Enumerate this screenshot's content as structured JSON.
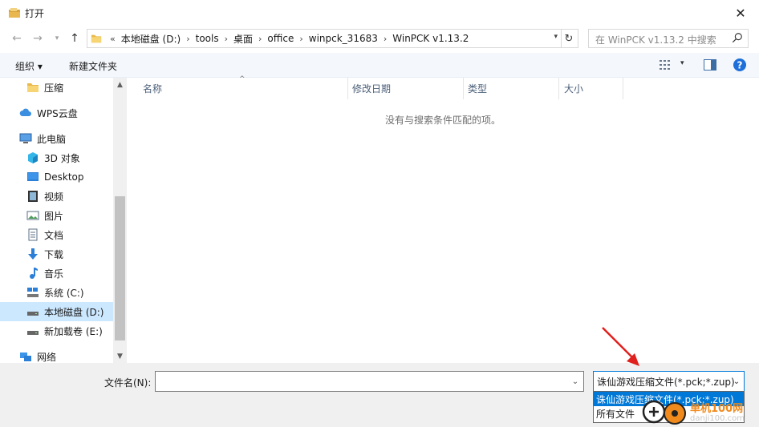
{
  "window": {
    "title": "打开",
    "close_glyph": "✕"
  },
  "address": {
    "overflow": "«",
    "crumbs": [
      "本地磁盘 (D:)",
      "tools",
      "桌面",
      "office",
      "winpck_31683",
      "WinPCK v1.13.2"
    ],
    "separator": "›"
  },
  "search": {
    "placeholder": "在 WinPCK v1.13.2 中搜索"
  },
  "toolbar": {
    "organize": "组织 ▾",
    "new_folder": "新建文件夹"
  },
  "sidebar": {
    "items": [
      {
        "label": "压缩",
        "icon": "folder-icon"
      },
      {
        "label": "WPS云盘",
        "icon": "cloud-icon"
      },
      {
        "label": "此电脑",
        "icon": "computer-icon"
      },
      {
        "label": "3D 对象",
        "icon": "3d-objects-icon"
      },
      {
        "label": "Desktop",
        "icon": "desktop-icon"
      },
      {
        "label": "视频",
        "icon": "video-icon"
      },
      {
        "label": "图片",
        "icon": "pictures-icon"
      },
      {
        "label": "文档",
        "icon": "documents-icon"
      },
      {
        "label": "下载",
        "icon": "download-icon"
      },
      {
        "label": "音乐",
        "icon": "music-icon"
      },
      {
        "label": "系统 (C:)",
        "icon": "system-drive-icon"
      },
      {
        "label": "本地磁盘 (D:)",
        "icon": "drive-icon"
      },
      {
        "label": "新加载卷 (E:)",
        "icon": "drive-icon"
      },
      {
        "label": "网络",
        "icon": "network-icon"
      }
    ]
  },
  "columns": [
    "名称",
    "修改日期",
    "类型",
    "大小"
  ],
  "empty_message": "没有与搜索条件匹配的项。",
  "bottom": {
    "filename_label": "文件名(N):",
    "filename_value": "",
    "filetype_selected": "诛仙游戏压缩文件(*.pck;*.zup)",
    "filetype_options": [
      "诛仙游戏压缩文件(*.pck;*.zup)",
      "所有文件"
    ]
  },
  "watermark": {
    "site": "单机100网",
    "url": "danji100.com"
  },
  "colors": {
    "accent": "#0078d7",
    "selection": "#cce8ff",
    "arrow": "#e0201d"
  }
}
